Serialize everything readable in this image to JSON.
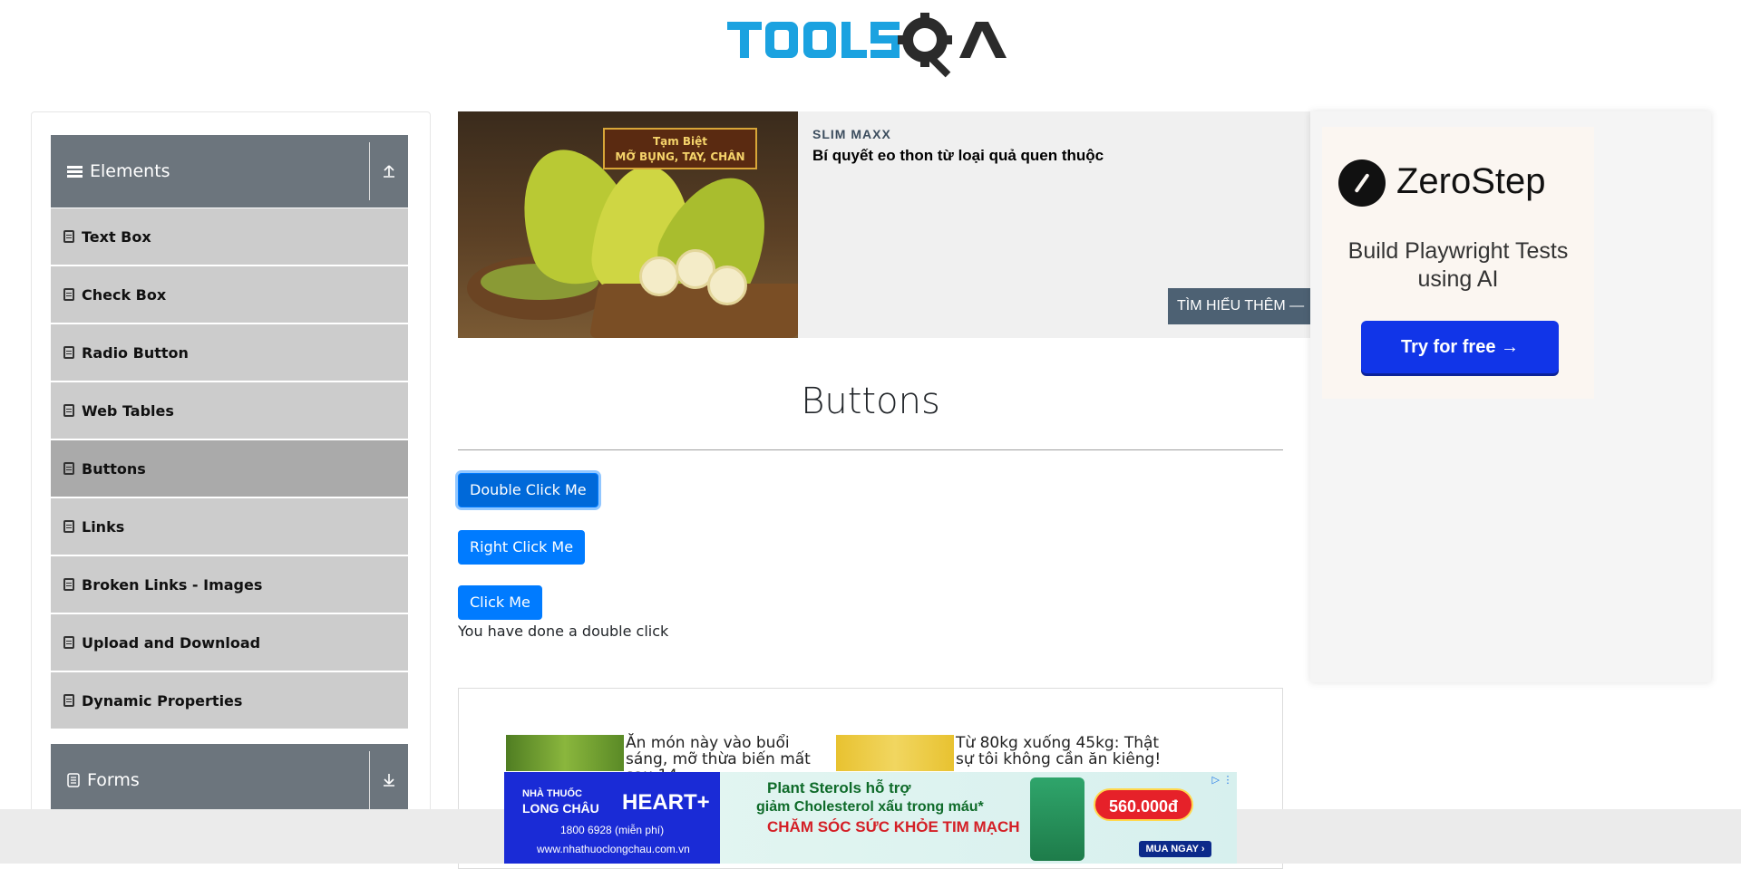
{
  "header": {
    "logo_alt": "TOOLSQA"
  },
  "sidebar": {
    "group_title": "Elements",
    "items": [
      {
        "label": "Text Box"
      },
      {
        "label": "Check Box"
      },
      {
        "label": "Radio Button"
      },
      {
        "label": "Web Tables"
      },
      {
        "label": "Buttons"
      },
      {
        "label": "Links"
      },
      {
        "label": "Broken Links - Images"
      },
      {
        "label": "Upload and Download"
      },
      {
        "label": "Dynamic Properties"
      }
    ],
    "next_group_title": "Forms"
  },
  "top_ad": {
    "tag_line1": "Tạm Biệt",
    "tag_line2": "MỠ BỤNG, TAY, CHÂN",
    "brand": "SLIM MAXX",
    "headline": "Bí quyết eo thon từ loại quả quen thuộc",
    "cta": "TÌM HIỂU THÊM —"
  },
  "right_ad": {
    "brand": "ZeroStep",
    "tagline": "Build Playwright Tests using AI",
    "cta": "Try for free →"
  },
  "main": {
    "title": "Buttons",
    "double_click_label": "Double Click Me",
    "right_click_label": "Right Click Me",
    "click_label": "Click Me",
    "message": "You have done a double click"
  },
  "recommendations": [
    {
      "text": "Ăn món này vào buổi sáng, mỡ thừa biến mất sau 14"
    },
    {
      "text": "Từ 80kg xuống 45kg: Thật sự tôi không cần ăn kiêng!"
    }
  ],
  "sticky_ad": {
    "pharmacy_line1": "NHÀ THUỐC",
    "pharmacy_line2": "LONG CHÂU",
    "product": "HEART+",
    "phone": "1800 6928 (miễn phí)",
    "website": "www.nhathuoclongchau.com.vn",
    "headline1": "Plant Sterols hỗ trợ",
    "headline2": "giảm Cholesterol xấu trong máu*",
    "headline3": "CHĂM SÓC SỨC KHỎE TIM MẠCH",
    "price": "560.000đ",
    "buy": "MUA NGAY ›"
  },
  "colors": {
    "sidebar_header": "#6c757d",
    "menu_item": "#cccccc",
    "menu_item_active": "#aaaaaa",
    "primary_button": "#007bff",
    "logo_blue": "#1ba2e0",
    "logo_dark": "#2b2b2b"
  }
}
